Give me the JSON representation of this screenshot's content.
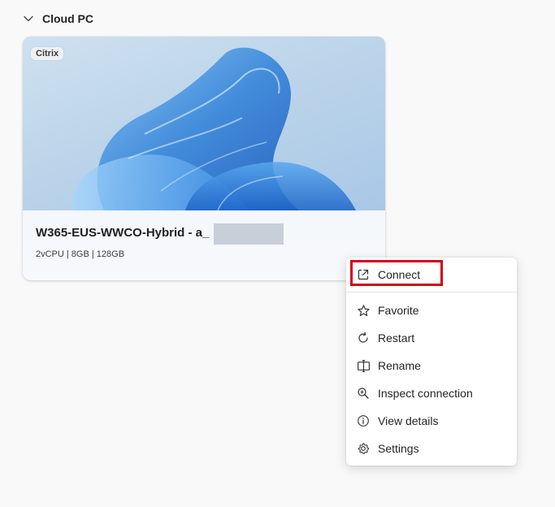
{
  "section": {
    "title": "Cloud PC",
    "chevron_icon": "chevron-down-icon"
  },
  "card": {
    "badge": "Citrix",
    "name": "W365-EUS-WWCO-Hybrid - a_",
    "specs": "2vCPU | 8GB | 128GB",
    "more_label": "...",
    "accent": "#3b82d6"
  },
  "menu": {
    "items": [
      {
        "label": "Connect",
        "icon": "open-external-icon"
      },
      {
        "label": "Favorite",
        "icon": "star-icon"
      },
      {
        "label": "Restart",
        "icon": "restart-icon"
      },
      {
        "label": "Rename",
        "icon": "rename-icon"
      },
      {
        "label": "Inspect connection",
        "icon": "inspect-icon"
      },
      {
        "label": "View details",
        "icon": "info-icon"
      },
      {
        "label": "Settings",
        "icon": "gear-icon"
      }
    ],
    "highlight_color": "#d6001c"
  }
}
